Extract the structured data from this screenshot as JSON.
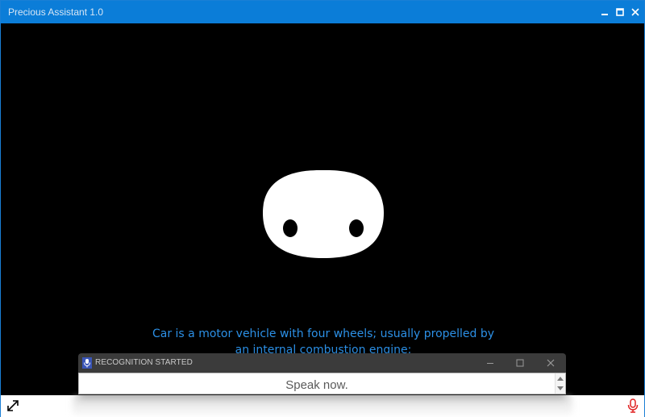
{
  "window": {
    "title": "Precious Assistant 1.0",
    "accent_color": "#0b7dd8",
    "controls": [
      "minimize-icon",
      "maximize-icon",
      "close-icon"
    ]
  },
  "stage": {
    "background": "#000000",
    "avatar": "blob-face-icon",
    "caption_lines": [
      "Car is a motor vehicle with four wheels; usually propelled by",
      "an internal combustion engine;"
    ],
    "caption_color": "#2c90e6"
  },
  "recognition": {
    "title": "RECOGNITION STARTED",
    "message": "Speak now.",
    "icon": "microphone-icon",
    "controls": [
      "minimize-icon",
      "maximize-icon",
      "close-icon"
    ]
  },
  "bottombar": {
    "left_icon": "expand-icon",
    "right_icon": "microphone-icon",
    "mic_color": "#e02020"
  }
}
